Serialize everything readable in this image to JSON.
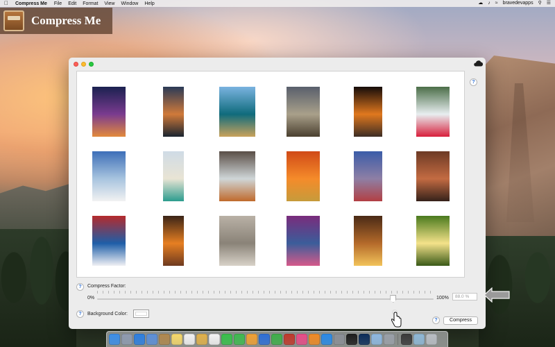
{
  "menubar": {
    "app_name": "Compress Me",
    "items": [
      "File",
      "Edit",
      "Format",
      "View",
      "Window",
      "Help"
    ],
    "user": "bravedevapps"
  },
  "banner": {
    "title": "Compress Me"
  },
  "window": {
    "gallery": {
      "rows": [
        [
          {
            "name": "palm-sunset",
            "colors": [
              "#1b2150",
              "#7a3b8f",
              "#e38a3c"
            ]
          },
          {
            "name": "ocean-sunset",
            "colors": [
              "#2a3a57",
              "#d07a3a",
              "#1a2430"
            ]
          },
          {
            "name": "coral-reef",
            "colors": [
              "#7ab3e0",
              "#0f6b7c",
              "#c9a25b"
            ]
          },
          {
            "name": "moon-field",
            "colors": [
              "#595f6c",
              "#a9a08a",
              "#4a3f2f"
            ]
          },
          {
            "name": "orange-moon",
            "colors": [
              "#150c0a",
              "#e0781e",
              "#3d2d24"
            ]
          },
          {
            "name": "tulip-fountain",
            "colors": [
              "#4b6e48",
              "#e8eef0",
              "#d81f3c"
            ]
          }
        ],
        [
          {
            "name": "snowy-beach",
            "colors": [
              "#3d6fb8",
              "#a8c4df",
              "#f2f2f2"
            ]
          },
          {
            "name": "lagoon",
            "colors": [
              "#cfdbe6",
              "#e9e4d4",
              "#2c9c8e"
            ]
          },
          {
            "name": "waterfall",
            "colors": [
              "#5a4e46",
              "#cfd6d8",
              "#c06a2c"
            ]
          },
          {
            "name": "horses-sunset",
            "colors": [
              "#d04a17",
              "#f58b2a",
              "#c69b3b"
            ]
          },
          {
            "name": "pebble-lake",
            "colors": [
              "#3b5ca8",
              "#8e7fa5",
              "#b23f43"
            ]
          },
          {
            "name": "red-canyon",
            "colors": [
              "#6d3a25",
              "#c36b42",
              "#35211a"
            ]
          }
        ],
        [
          {
            "name": "fuji-blossom",
            "colors": [
              "#b52a2c",
              "#1e5ea8",
              "#f0f0f4"
            ]
          },
          {
            "name": "cave-glow",
            "colors": [
              "#3a2417",
              "#e67f22",
              "#6e3a1f"
            ]
          },
          {
            "name": "river-stones",
            "colors": [
              "#b9b1a6",
              "#8a8378",
              "#d8d2c8"
            ]
          },
          {
            "name": "lotus-pond",
            "colors": [
              "#7a2c7c",
              "#3b5d9a",
              "#d55a8a"
            ]
          },
          {
            "name": "slot-canyon",
            "colors": [
              "#4a2a16",
              "#b46a2a",
              "#f2c35a"
            ]
          },
          {
            "name": "forest-light",
            "colors": [
              "#4a7a1e",
              "#f4e28a",
              "#3a5a18"
            ]
          }
        ]
      ]
    },
    "compress_factor": {
      "label": "Compress Factor:",
      "min_label": "0%",
      "max_label": "100%",
      "value": 0.88,
      "value_text": "88.0 %"
    },
    "background_color": {
      "label": "Background Color:",
      "value": "#ffffff"
    },
    "compress_button": "Compress",
    "help": "?"
  },
  "dock": {
    "icons": [
      {
        "name": "finder",
        "color": "#3c8ee8"
      },
      {
        "name": "launchpad",
        "color": "#8f9bb0"
      },
      {
        "name": "safari",
        "color": "#2d7fe0"
      },
      {
        "name": "mail",
        "color": "#5c8fd8"
      },
      {
        "name": "contacts",
        "color": "#b0884e"
      },
      {
        "name": "notes",
        "color": "#f5d86b"
      },
      {
        "name": "reminders",
        "color": "#f2f2f2"
      },
      {
        "name": "photos",
        "color": "#e0b14a"
      },
      {
        "name": "calendar",
        "color": "#f3f3f3"
      },
      {
        "name": "messages",
        "color": "#38c04b"
      },
      {
        "name": "facetime",
        "color": "#3fb950"
      },
      {
        "name": "pages",
        "color": "#f0a034"
      },
      {
        "name": "keynote",
        "color": "#2e6fd6"
      },
      {
        "name": "numbers",
        "color": "#3fae4a"
      },
      {
        "name": "photo-booth",
        "color": "#c0392b"
      },
      {
        "name": "itunes",
        "color": "#e84c88"
      },
      {
        "name": "ibooks",
        "color": "#f08a24"
      },
      {
        "name": "app-store",
        "color": "#2a8ae6"
      },
      {
        "name": "system-preferences",
        "color": "#8b8f96"
      },
      {
        "name": "terminal",
        "color": "#1d1d1d"
      },
      {
        "name": "photoshop",
        "color": "#0c2d5a"
      },
      {
        "name": "preview",
        "color": "#8eb8e0"
      },
      {
        "name": "help",
        "color": "#9aa0a8"
      },
      {
        "name": "screen",
        "color": "#3a3a3a"
      },
      {
        "name": "downloads",
        "color": "#8fb8d6"
      },
      {
        "name": "trash",
        "color": "#b9bec4"
      }
    ]
  }
}
